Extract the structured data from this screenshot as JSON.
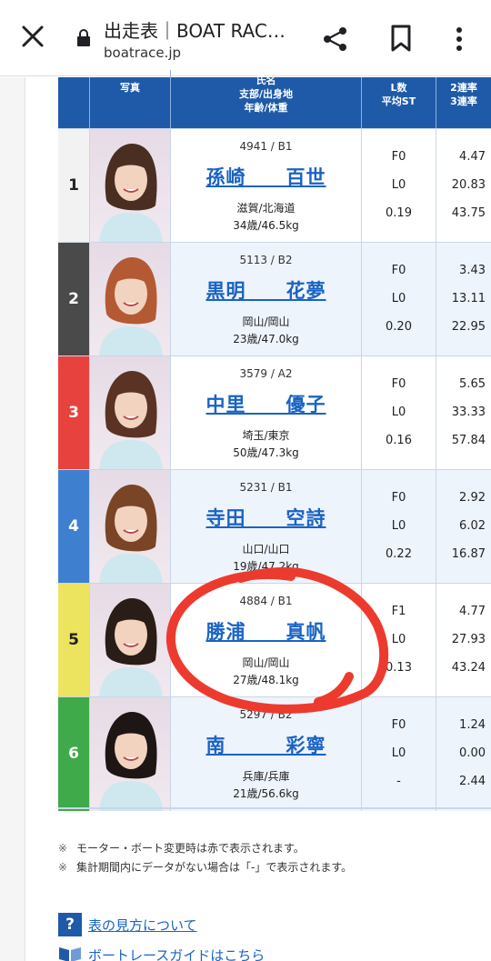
{
  "browser": {
    "title": "出走表｜BOAT RAC…",
    "url": "boatrace.jp"
  },
  "table": {
    "headers": {
      "photo": "写真",
      "name": "氏名",
      "branch": "支部/出身地",
      "age": "年齢/体重",
      "l_count": "L数",
      "avg_st": "平均ST",
      "rate2": "2連率",
      "rate3": "3連率"
    },
    "rows": [
      {
        "num": "1",
        "reg": "4941 / B1",
        "name": "孫崎　　百世",
        "branch": "滋賀/北海道",
        "age": "34歳/46.5kg",
        "f": "F0",
        "l": "L0",
        "st": "0.19",
        "r1": "4.47",
        "r2": "20.83",
        "r3": "43.75",
        "color": "#f2f2f2",
        "numcolor": "#222"
      },
      {
        "num": "2",
        "reg": "5113 / B2",
        "name": "黒明　　花夢",
        "branch": "岡山/岡山",
        "age": "23歳/47.0kg",
        "f": "F0",
        "l": "L0",
        "st": "0.20",
        "r1": "3.43",
        "r2": "13.11",
        "r3": "22.95",
        "color": "#4a4a4a",
        "numcolor": "#fff"
      },
      {
        "num": "3",
        "reg": "3579 / A2",
        "name": "中里　　優子",
        "branch": "埼玉/東京",
        "age": "50歳/47.3kg",
        "f": "F0",
        "l": "L0",
        "st": "0.16",
        "r1": "5.65",
        "r2": "33.33",
        "r3": "57.84",
        "color": "#e8423e",
        "numcolor": "#fff"
      },
      {
        "num": "4",
        "reg": "5231 / B1",
        "name": "寺田　　空詩",
        "branch": "山口/山口",
        "age": "19歳/47.2kg",
        "f": "F0",
        "l": "L0",
        "st": "0.22",
        "r1": "2.92",
        "r2": "6.02",
        "r3": "16.87",
        "color": "#3f7fd0",
        "numcolor": "#fff"
      },
      {
        "num": "5",
        "reg": "4884 / B1",
        "name": "勝浦　　真帆",
        "branch": "岡山/岡山",
        "age": "27歳/48.1kg",
        "f": "F1",
        "l": "L0",
        "st": "0.13",
        "r1": "4.77",
        "r2": "27.93",
        "r3": "43.24",
        "color": "#ece35f",
        "numcolor": "#222"
      },
      {
        "num": "6",
        "reg": "5297 / B2",
        "name": "南　　　彩寧",
        "branch": "兵庫/兵庫",
        "age": "21歳/56.6kg",
        "f": "F0",
        "l": "L0",
        "st": "-",
        "r1": "1.24",
        "r2": "0.00",
        "r3": "2.44",
        "color": "#3faa4a",
        "numcolor": "#fff"
      }
    ]
  },
  "notes": {
    "mark": "※",
    "note1": "モーター・ボート変更時は赤で表示されます。",
    "note2": "集計期間内にデータがない場合は「-」で表示されます。"
  },
  "links": {
    "help_icon": "?",
    "help": "表の見方について",
    "guide": "ボートレースガイドはこちら"
  }
}
